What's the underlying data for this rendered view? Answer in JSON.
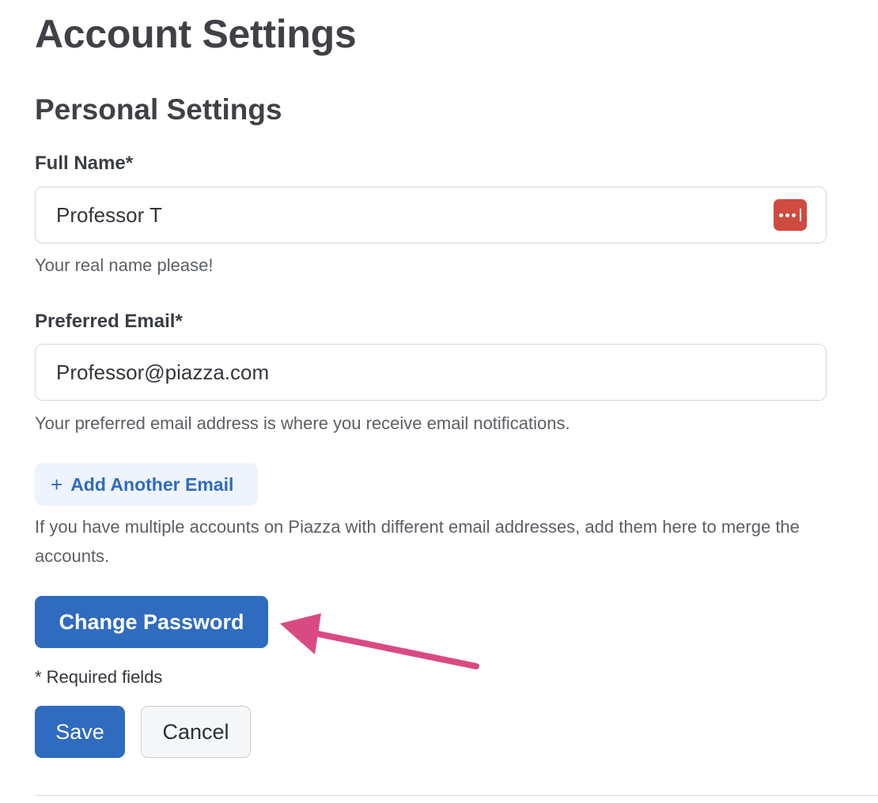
{
  "page": {
    "title": "Account Settings",
    "section_title": "Personal Settings"
  },
  "full_name": {
    "label": "Full Name*",
    "value": "Professor T",
    "help": "Your real name please!",
    "autofill_icon": "password-manager-icon"
  },
  "preferred_email": {
    "label": "Preferred Email*",
    "value": "Professor@piazza.com",
    "help": "Your preferred email address is where you receive email notifications."
  },
  "add_email": {
    "icon": "plus-icon",
    "icon_glyph": "+",
    "label": "Add Another Email",
    "help": "If you have multiple accounts on Piazza with different email addresses, add them here to merge the accounts."
  },
  "change_password": {
    "label": "Change Password"
  },
  "required_note": "* Required fields",
  "actions": {
    "save_label": "Save",
    "cancel_label": "Cancel"
  },
  "colors": {
    "primary": "#2f6bbf",
    "autofill_icon": "#cf4b3f",
    "annotation_arrow": "#d94a83"
  }
}
